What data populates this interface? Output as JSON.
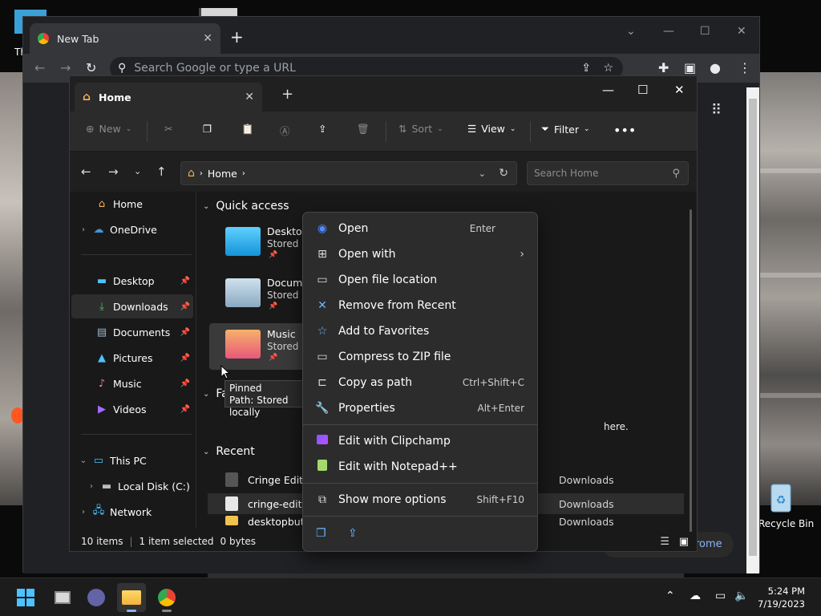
{
  "desktop": {
    "recycle_bin_label": "Recycle Bin"
  },
  "chrome": {
    "tab_title": "New Tab",
    "omnibox_placeholder": "Search Google or type a URL",
    "page_partial_text": "rome"
  },
  "explorer": {
    "tab_title": "Home",
    "command_bar": {
      "new_label": "New",
      "sort_label": "Sort",
      "view_label": "View",
      "filter_label": "Filter"
    },
    "address": {
      "path_label": "Home",
      "search_placeholder": "Search Home"
    },
    "nav": {
      "home": "Home",
      "onedrive": "OneDrive",
      "desktop": "Desktop",
      "downloads": "Downloads",
      "documents": "Documents",
      "pictures": "Pictures",
      "music": "Music",
      "videos": "Videos",
      "this_pc": "This PC",
      "local_disk": "Local Disk (C:)",
      "network": "Network"
    },
    "quick_access": {
      "header": "Quick access",
      "tiles": [
        {
          "name": "Desktop",
          "sub": "Stored locally"
        },
        {
          "name": "Documents",
          "sub": "Stored locally"
        },
        {
          "name": "Music",
          "sub": "Stored locally"
        }
      ]
    },
    "favorites_header": "Favorites",
    "favorites_partial": "here.",
    "recent": {
      "header": "Recent",
      "rows": [
        {
          "name": "Cringe Edit",
          "location": "Downloads"
        },
        {
          "name": "cringe-edit-",
          "location": "Downloads"
        },
        {
          "name": "desktopbut",
          "location": "Downloads"
        }
      ]
    },
    "status": {
      "items": "10 items",
      "selected": "1 item selected",
      "size": "0 bytes"
    }
  },
  "tooltip": {
    "line1": "Pinned",
    "line2": "Path: Stored locally"
  },
  "context_menu": {
    "items": [
      {
        "label": "Open",
        "shortcut": "Enter"
      },
      {
        "label": "Open with",
        "shortcut": ""
      },
      {
        "label": "Open file location",
        "shortcut": ""
      },
      {
        "label": "Remove from Recent",
        "shortcut": ""
      },
      {
        "label": "Add to Favorites",
        "shortcut": ""
      },
      {
        "label": "Compress to ZIP file",
        "shortcut": ""
      },
      {
        "label": "Copy as path",
        "shortcut": "Ctrl+Shift+C"
      },
      {
        "label": "Properties",
        "shortcut": "Alt+Enter"
      },
      {
        "label": "Edit with Clipchamp",
        "shortcut": ""
      },
      {
        "label": "Edit with Notepad++",
        "shortcut": ""
      },
      {
        "label": "Show more options",
        "shortcut": "Shift+F10"
      }
    ]
  },
  "taskbar": {
    "time": "5:24 PM",
    "date": "7/19/2023"
  },
  "colors": {
    "accent": "#0078d4",
    "folder_yellow": "#f2c14e",
    "chrome_bg": "#202124"
  }
}
